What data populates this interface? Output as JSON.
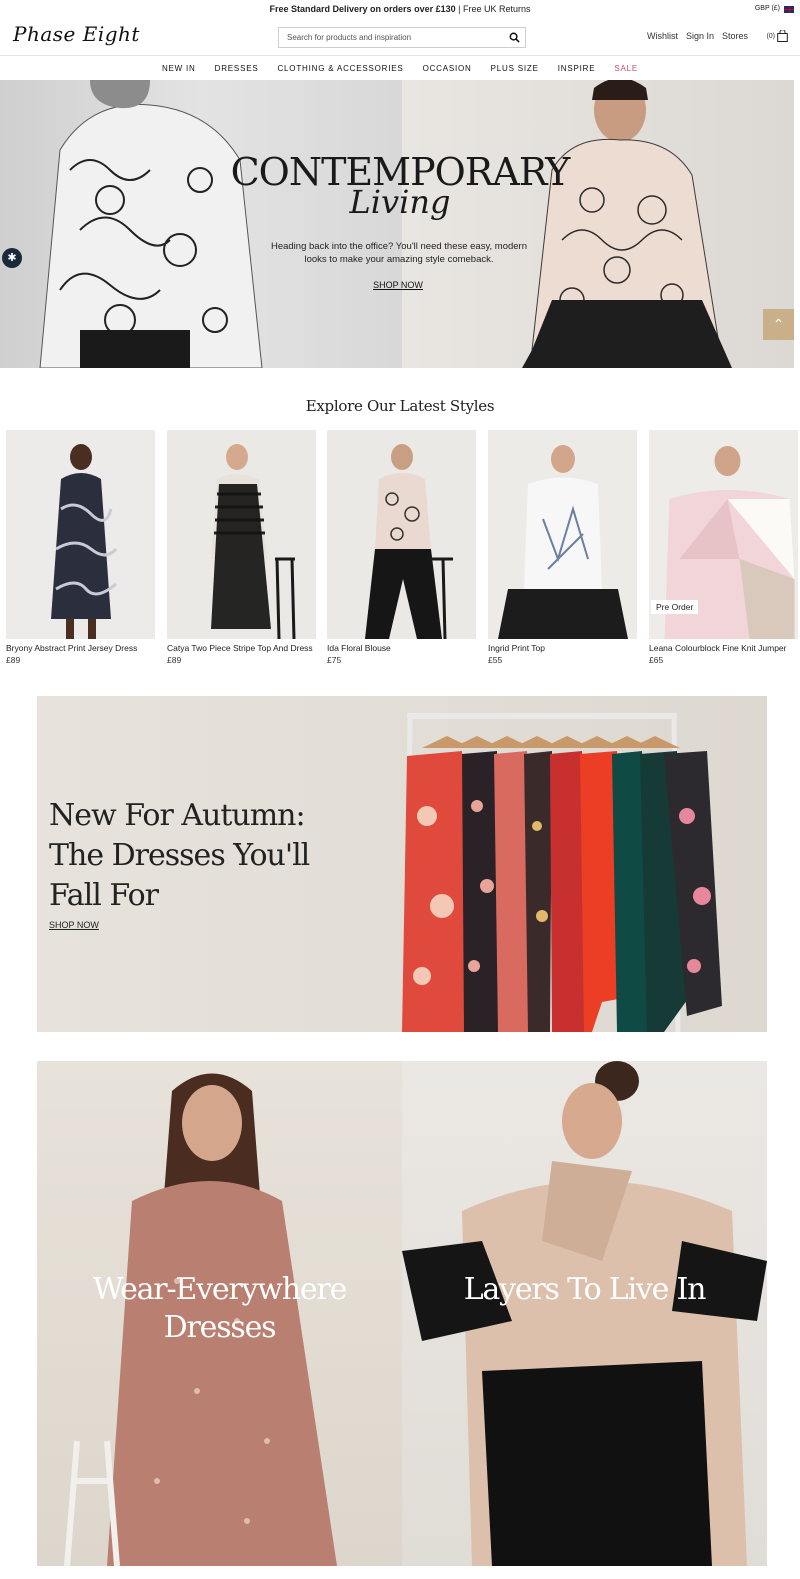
{
  "topbar": {
    "promo_bold": "Free Standard Delivery on orders over £130",
    "promo_rest": " | Free UK Returns",
    "currency": "GBP (£)"
  },
  "header": {
    "logo": "Phase Eight",
    "search_placeholder": "Search for products and inspiration",
    "links": [
      "Wishlist",
      "Sign In",
      "Stores"
    ],
    "bag_count": "(0)"
  },
  "nav": {
    "items": [
      "NEW IN",
      "DRESSES",
      "CLOTHING & ACCESSORIES",
      "OCCASION",
      "PLUS SIZE",
      "INSPIRE",
      "SALE"
    ]
  },
  "hero": {
    "title": "CONTEMPORARY",
    "script": "Living",
    "text": "Heading back into the office? You'll need these easy, modern looks to make your amazing style comeback.",
    "cta": "SHOP NOW"
  },
  "latest": {
    "title": "Explore Our Latest Styles",
    "products": [
      {
        "name": "Bryony Abstract Print Jersey Dress",
        "price": "£89",
        "badge": ""
      },
      {
        "name": "Catya Two Piece Stripe Top And Dress",
        "price": "£89",
        "badge": ""
      },
      {
        "name": "Ida Floral Blouse",
        "price": "£75",
        "badge": ""
      },
      {
        "name": "Ingrid Print Top",
        "price": "£55",
        "badge": ""
      },
      {
        "name": "Leana Colourblock Fine Knit Jumper",
        "price": "£65",
        "badge": "Pre Order"
      }
    ]
  },
  "autumn": {
    "title": "New For Autumn: The Dresses You'll Fall For",
    "cta": "SHOP NOW"
  },
  "tiles": [
    {
      "title": "Wear-Everywhere Dresses"
    },
    {
      "title": "Layers To Live In"
    }
  ],
  "colors": {
    "sale": "#c0506a",
    "accent": "#c9b08a"
  }
}
